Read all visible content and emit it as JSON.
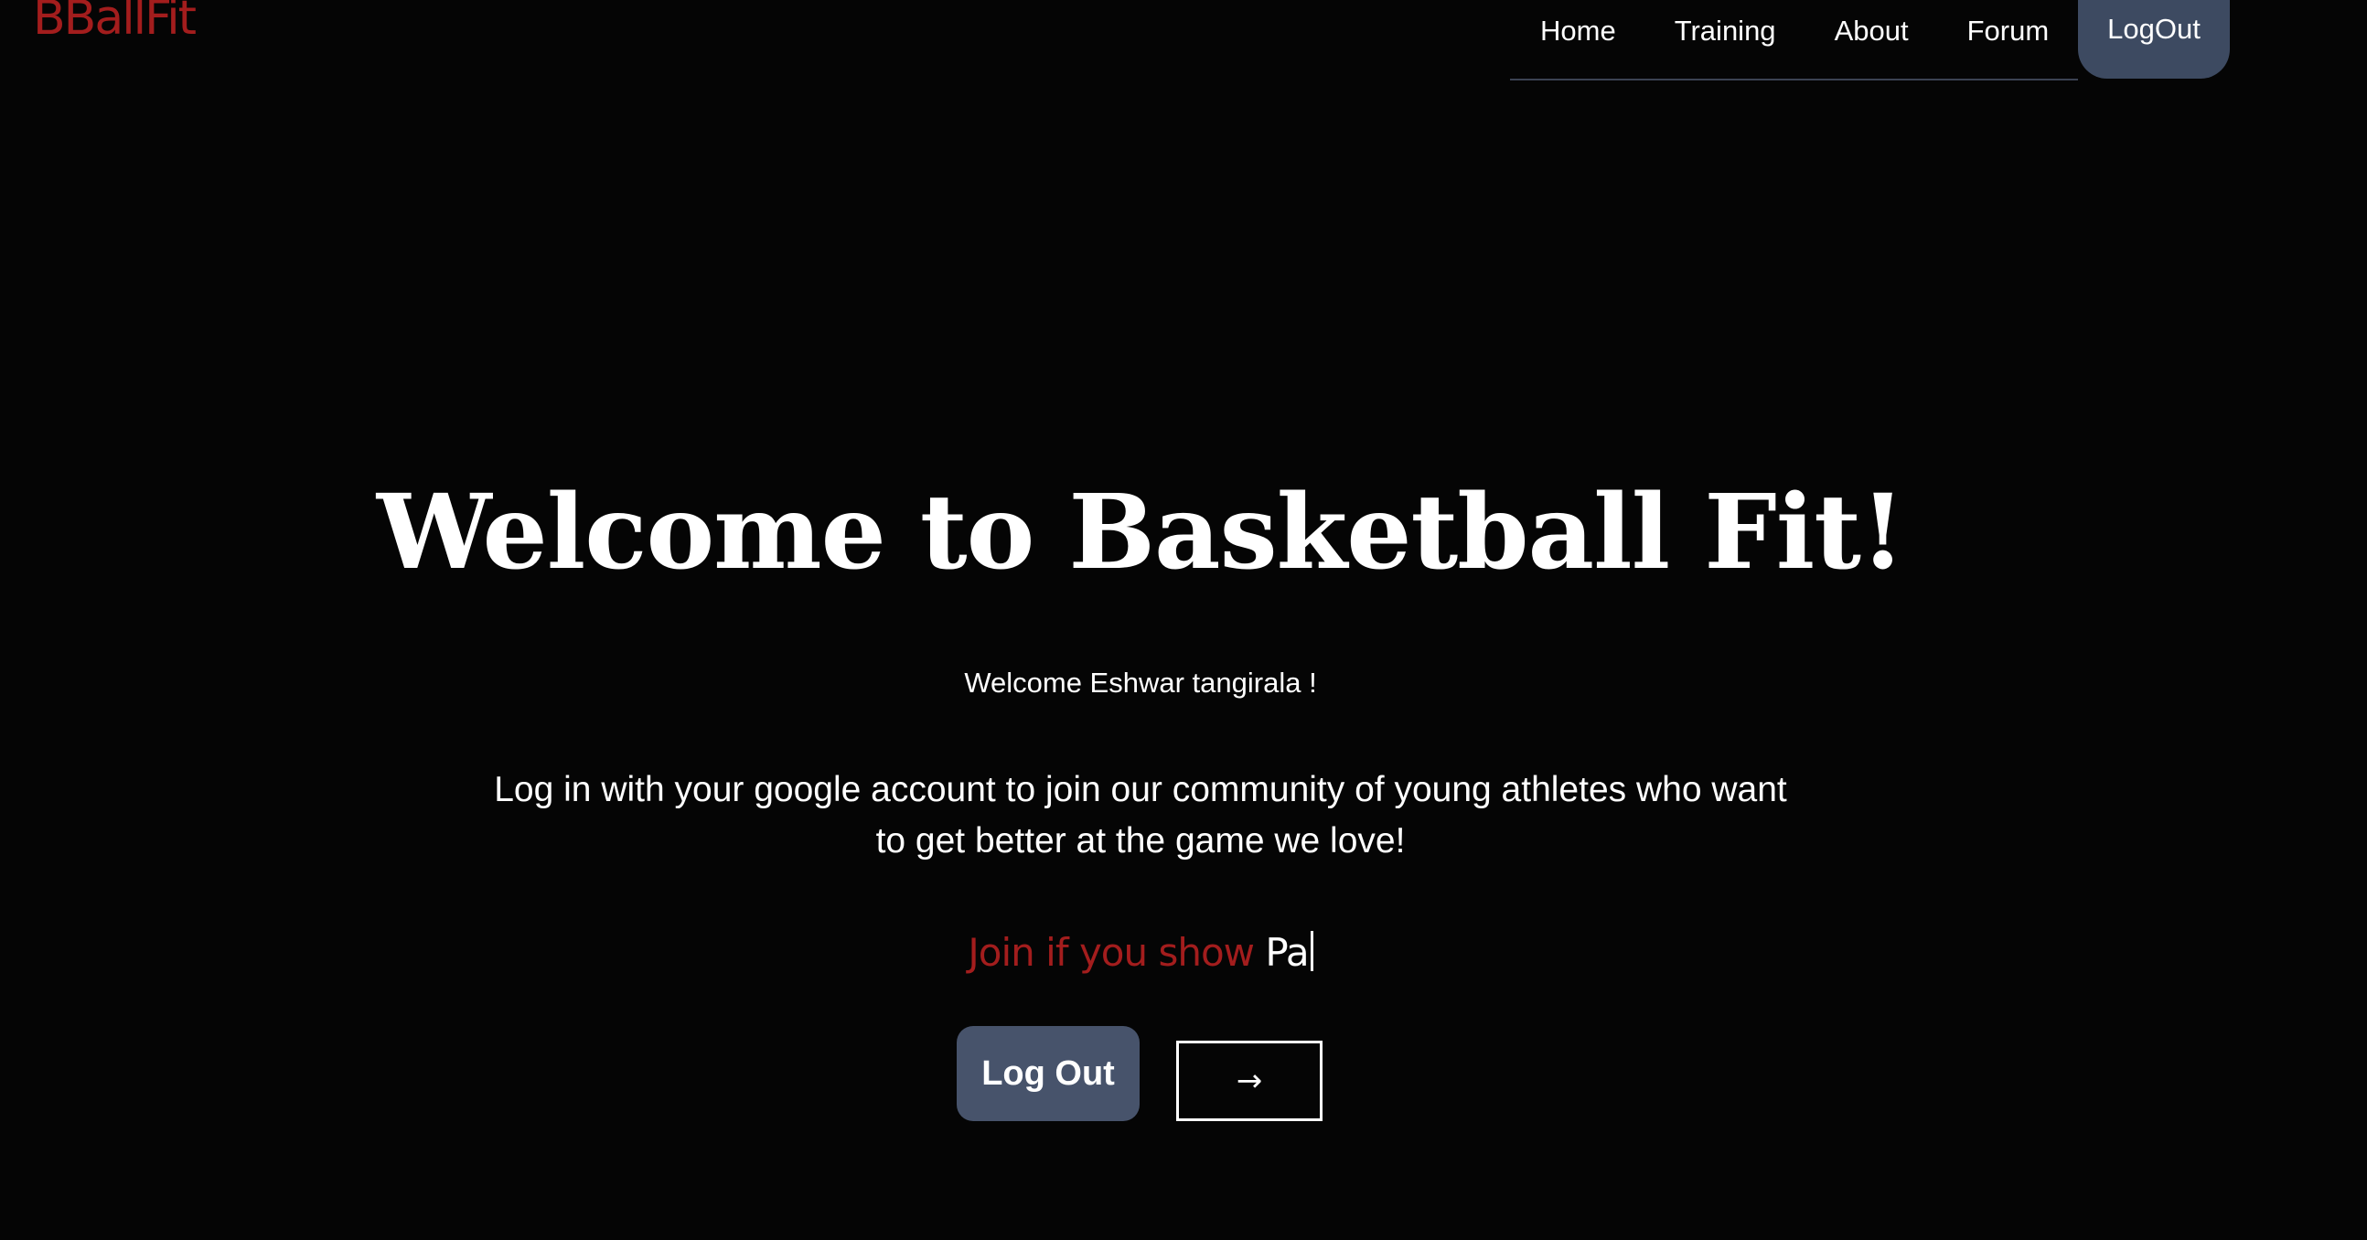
{
  "header": {
    "logo": "BBallFit",
    "nav": {
      "links": [
        "Home",
        "Training",
        "About",
        "Forum"
      ],
      "logout_label": "LogOut"
    }
  },
  "hero": {
    "title": "Welcome to Basketball Fit!",
    "welcome_user": "Welcome Eshwar tangirala !",
    "description": "Log in with your google account to join our community of young athletes who want to get better at the game we love!",
    "tagline_static": "Join if you show",
    "tagline_typed": "Pa",
    "logout_button": "Log Out",
    "arrow_button": "→"
  },
  "colors": {
    "background": "#050505",
    "brand_red": "#a31d1d",
    "button_slate": "#47536b",
    "nav_logout_bg": "#3d4a61"
  },
  "icons": {
    "arrow": "arrow-right-icon"
  }
}
